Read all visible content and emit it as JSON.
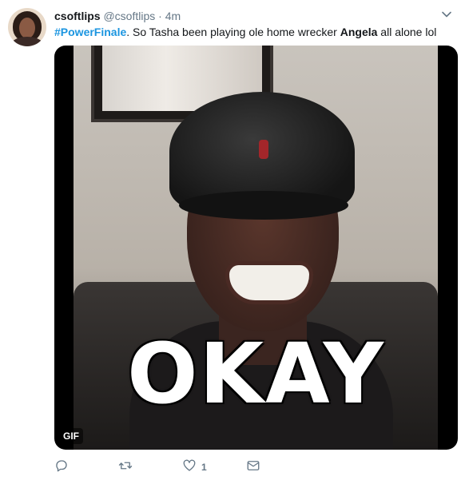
{
  "tweet": {
    "display_name": "csoftlips",
    "handle": "@csoftlips",
    "separator": "·",
    "time": "4m",
    "text": {
      "hashtag": "#PowerFinale",
      "part1": ". So Tasha been playing ole home wrecker ",
      "bold_name": "Angela",
      "part2": " all alone lol"
    },
    "media": {
      "caption": "OKAY",
      "badge": "GIF"
    },
    "actions": {
      "reply_icon": "reply-icon",
      "retweet_icon": "retweet-icon",
      "like_icon": "like-icon",
      "like_count": "1",
      "dm_icon": "dm-icon"
    }
  },
  "colors": {
    "link": "#1b95e0",
    "secondary_text": "#657786",
    "primary_text": "#14171a"
  }
}
